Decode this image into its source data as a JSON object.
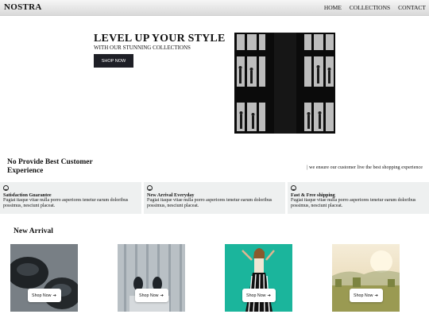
{
  "header": {
    "brand": "NOSTRA",
    "nav": [
      "HOME",
      "COLLECTIONS",
      "CONTACT"
    ]
  },
  "hero": {
    "title": "LEVEL UP YOUR STYLE",
    "subtitle": "WITH OUR STUNNING COLLECTIONS",
    "button": "SHOP NOW",
    "image_icon": "building-windows-photo"
  },
  "experience": {
    "title": "No Provide Best Customer Experience",
    "tagline": "| we ensure our customer live the best shopping experience"
  },
  "features": [
    {
      "icon": "smile-icon",
      "title": "Satisfaction Guarantee",
      "text": "Fugiat itaque vitae nulla porro asperiores tenetur earum doloribus possimus, nesciunt placeat."
    },
    {
      "icon": "smile-icon",
      "title": "New Arrival Everyday",
      "text": "Fugiat itaque vitae nulla porro asperiores tenetur earum doloribus possimus, nesciunt placeat."
    },
    {
      "icon": "smile-icon",
      "title": "Fast & Free shipping",
      "text": "Fugiat itaque vitae nulla porro asperiores tenetur earum doloribus possimus, nesciunt placeat."
    }
  ],
  "arrivals": {
    "title": "New Arrival",
    "button_label": "Shop Now",
    "arrow_icon": "arrow-right-icon",
    "cards": [
      {
        "photo": "black-shoes-photo"
      },
      {
        "photo": "wooden-floor-shoes-photo"
      },
      {
        "photo": "woman-striped-pants-teal-photo"
      },
      {
        "photo": "sunny-field-photo"
      }
    ]
  }
}
